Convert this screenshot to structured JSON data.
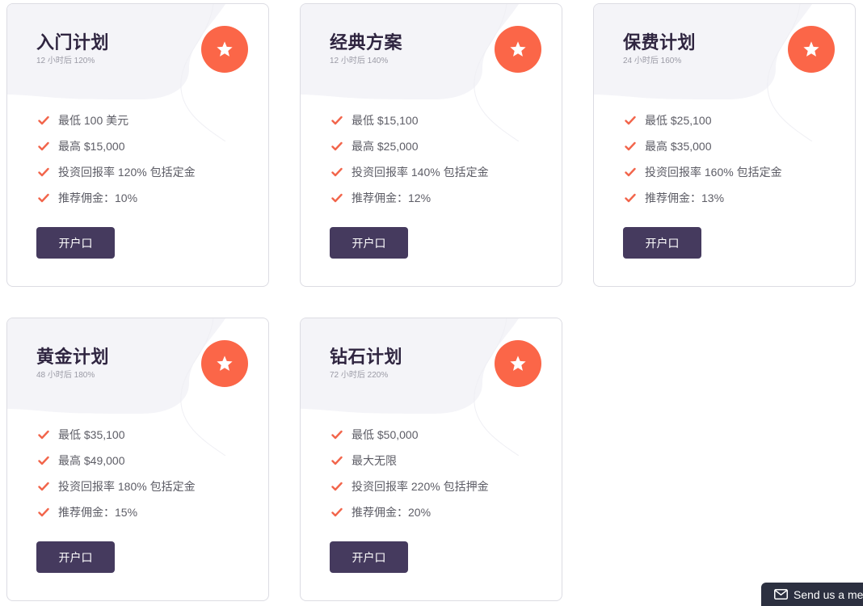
{
  "plans": [
    {
      "title": "入门计划",
      "subtitle": "12 小时后 120%",
      "features": [
        "最低 100 美元",
        "最高 $15,000",
        "投资回报率 120% 包括定金",
        "推荐佣金：10%"
      ],
      "button_label": "开户口"
    },
    {
      "title": "经典方案",
      "subtitle": "12 小时后 140%",
      "features": [
        "最低 $15,100",
        "最高 $25,000",
        "投资回报率 140% 包括定金",
        "推荐佣金：12%"
      ],
      "button_label": "开户口"
    },
    {
      "title": "保费计划",
      "subtitle": "24 小时后 160%",
      "features": [
        "最低 $25,100",
        "最高 $35,000",
        "投资回报率 160% 包括定金",
        "推荐佣金：13%"
      ],
      "button_label": "开户口"
    },
    {
      "title": "黄金计划",
      "subtitle": "48 小时后 180%",
      "features": [
        "最低 $35,100",
        "最高 $49,000",
        "投资回报率 180% 包括定金",
        "推荐佣金：15%"
      ],
      "button_label": "开户口"
    },
    {
      "title": "钻石计划",
      "subtitle": "72 小时后 220%",
      "features": [
        "最低 $50,000",
        "最大无限",
        "投资回报率 220% 包括押金",
        "推荐佣金：20%"
      ],
      "button_label": "开户口"
    }
  ],
  "icons": {
    "badge": "star-icon",
    "feature": "check-icon",
    "chat": "envelope-icon"
  },
  "colors": {
    "accent": "#fb6648",
    "button": "#453a5e",
    "title": "#2f2540",
    "chat_bg": "#2c3040"
  },
  "chat": {
    "label": "Send us a mes"
  }
}
